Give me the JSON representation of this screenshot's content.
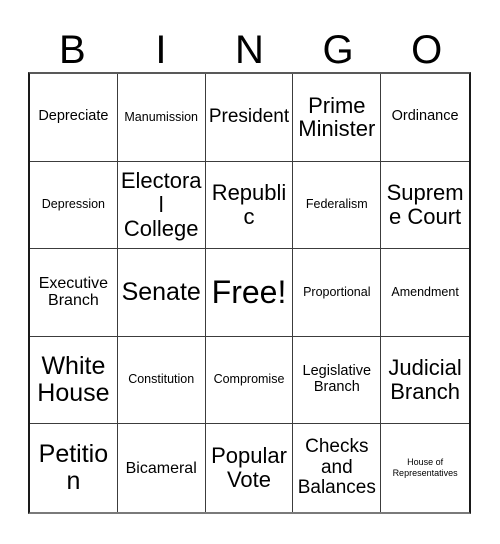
{
  "card": {
    "title": "BINGO",
    "header_letters": [
      "B",
      "I",
      "N",
      "G",
      "O"
    ],
    "columns": 5,
    "rows": 5,
    "free_space": {
      "row": 3,
      "column": 3,
      "label": "Free!"
    },
    "colors": {
      "background": "#ffffff",
      "text": "#000000",
      "grid_line": "#3c3c3c",
      "outer_border": "#1a1a1a"
    },
    "cells": [
      {
        "id": "cell-r1c1",
        "text": "Depreciate",
        "size": "fs-m",
        "row": 1,
        "col": 1
      },
      {
        "id": "cell-r1c2",
        "text": "Manumission",
        "size": "fs-s",
        "row": 1,
        "col": 2
      },
      {
        "id": "cell-r1c3",
        "text": "President",
        "size": "fs-l",
        "row": 1,
        "col": 3
      },
      {
        "id": "cell-r1c4",
        "text": "Prime Minister",
        "size": "fs-xl",
        "row": 1,
        "col": 4
      },
      {
        "id": "cell-r1c5",
        "text": "Ordinance",
        "size": "fs-m",
        "row": 1,
        "col": 5
      },
      {
        "id": "cell-r2c1",
        "text": "Depression",
        "size": "fs-s",
        "row": 2,
        "col": 1
      },
      {
        "id": "cell-r2c2",
        "text": "Electoral College",
        "size": "fs-xl",
        "row": 2,
        "col": 2
      },
      {
        "id": "cell-r2c3",
        "text": "Republic",
        "size": "fs-xl",
        "row": 2,
        "col": 3
      },
      {
        "id": "cell-r2c4",
        "text": "Federalism",
        "size": "fs-s",
        "row": 2,
        "col": 4
      },
      {
        "id": "cell-r2c5",
        "text": "Supreme Court",
        "size": "fs-xl",
        "row": 2,
        "col": 5
      },
      {
        "id": "cell-r3c1",
        "text": "Executive Branch",
        "size": "fs-ml",
        "row": 3,
        "col": 1
      },
      {
        "id": "cell-r3c2",
        "text": "Senate",
        "size": "fs-xxl",
        "row": 3,
        "col": 2
      },
      {
        "id": "cell-r3c3",
        "text": "Free!",
        "size": "fs-free",
        "row": 3,
        "col": 3
      },
      {
        "id": "cell-r3c4",
        "text": "Proportional",
        "size": "fs-s",
        "row": 3,
        "col": 4
      },
      {
        "id": "cell-r3c5",
        "text": "Amendment",
        "size": "fs-s",
        "row": 3,
        "col": 5
      },
      {
        "id": "cell-r4c1",
        "text": "White House",
        "size": "fs-xxl",
        "row": 4,
        "col": 1
      },
      {
        "id": "cell-r4c2",
        "text": "Constitution",
        "size": "fs-s",
        "row": 4,
        "col": 2
      },
      {
        "id": "cell-r4c3",
        "text": "Compromise",
        "size": "fs-s",
        "row": 4,
        "col": 3
      },
      {
        "id": "cell-r4c4",
        "text": "Legislative Branch",
        "size": "fs-m",
        "row": 4,
        "col": 4
      },
      {
        "id": "cell-r4c5",
        "text": "Judicial Branch",
        "size": "fs-xl",
        "row": 4,
        "col": 5
      },
      {
        "id": "cell-r5c1",
        "text": "Petition",
        "size": "fs-xxl",
        "row": 5,
        "col": 1
      },
      {
        "id": "cell-r5c2",
        "text": "Bicameral",
        "size": "fs-ml",
        "row": 5,
        "col": 2
      },
      {
        "id": "cell-r5c3",
        "text": "Popular Vote",
        "size": "fs-xl",
        "row": 5,
        "col": 3
      },
      {
        "id": "cell-r5c4",
        "text": "Checks and Balances",
        "size": "fs-l",
        "row": 5,
        "col": 4
      },
      {
        "id": "cell-r5c5",
        "text": "House of Representatives",
        "size": "fs-xxs",
        "row": 5,
        "col": 5
      }
    ]
  }
}
